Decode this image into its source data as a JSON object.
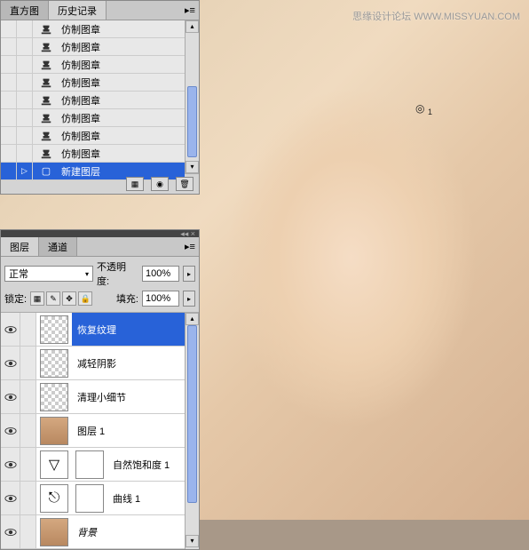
{
  "watermark": "思缘设计论坛  WWW.MISSYUAN.COM",
  "history": {
    "tabs": [
      "直方图",
      "历史记录"
    ],
    "active_tab": 1,
    "items": [
      {
        "icon": "stamp",
        "label": "仿制图章",
        "selected": false
      },
      {
        "icon": "stamp",
        "label": "仿制图章",
        "selected": false,
        "marker": ""
      },
      {
        "icon": "stamp",
        "label": "仿制图章",
        "selected": false
      },
      {
        "icon": "stamp",
        "label": "仿制图章",
        "selected": false
      },
      {
        "icon": "stamp",
        "label": "仿制图章",
        "selected": false
      },
      {
        "icon": "stamp",
        "label": "仿制图章",
        "selected": false
      },
      {
        "icon": "stamp",
        "label": "仿制图章",
        "selected": false
      },
      {
        "icon": "stamp",
        "label": "仿制图章",
        "selected": false
      },
      {
        "icon": "layer-new",
        "label": "新建图层",
        "selected": true,
        "marker": "▷"
      }
    ]
  },
  "layers": {
    "tabs": [
      "图层",
      "通道"
    ],
    "active_tab": 0,
    "blend_mode": "正常",
    "opacity_label": "不透明度:",
    "opacity": "100%",
    "lock_label": "锁定:",
    "fill_label": "填充:",
    "fill": "100%",
    "items": [
      {
        "name": "恢复纹理",
        "thumb": "checker",
        "selected": true,
        "eye": true
      },
      {
        "name": "减轻阴影",
        "thumb": "checker",
        "selected": false,
        "eye": true
      },
      {
        "name": "清理小细节",
        "thumb": "checker",
        "selected": false,
        "eye": true
      },
      {
        "name": "图层 1",
        "thumb": "photo",
        "selected": false,
        "eye": true
      },
      {
        "name": "自然饱和度 1",
        "thumb": "adj-v",
        "mask": true,
        "selected": false,
        "eye": true
      },
      {
        "name": "曲线 1",
        "thumb": "adj-curve",
        "mask": true,
        "selected": false,
        "eye": true
      },
      {
        "name": "背景",
        "thumb": "photo",
        "selected": false,
        "eye": true,
        "bg": true
      }
    ]
  }
}
